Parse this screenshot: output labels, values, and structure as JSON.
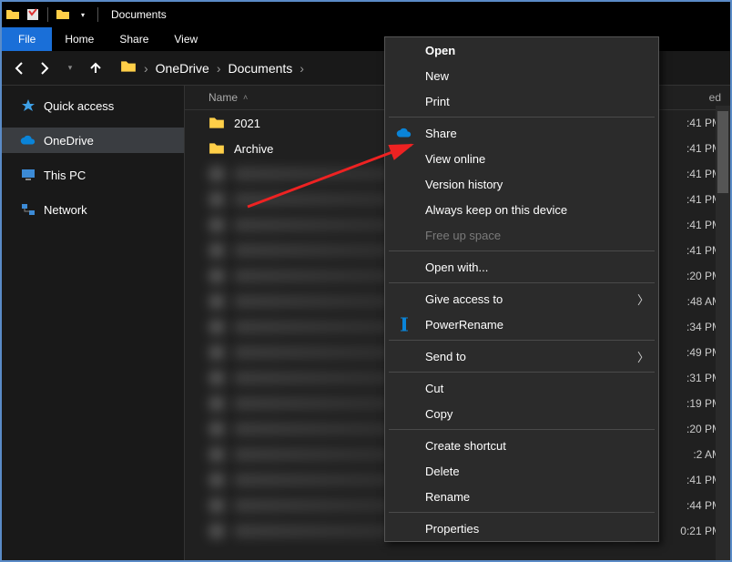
{
  "titlebar": {
    "title": "Documents"
  },
  "ribbon": {
    "file": "File",
    "tabs": [
      "Home",
      "Share",
      "View"
    ]
  },
  "breadcrumb": {
    "items": [
      "OneDrive",
      "Documents"
    ]
  },
  "sidebar": {
    "items": [
      {
        "label": "Quick access"
      },
      {
        "label": "OneDrive"
      },
      {
        "label": "This PC"
      },
      {
        "label": "Network"
      }
    ]
  },
  "columns": {
    "name": "Name",
    "date_partial": "ed"
  },
  "files": {
    "visible": [
      {
        "name": "2021",
        "date": ":41 PM"
      },
      {
        "name": "Archive",
        "date": ":41 PM"
      }
    ],
    "blurred_dates": [
      ":41 PM",
      ":41 PM",
      ":41 PM",
      ":41 PM",
      ":20 PM",
      ":48 AM",
      ":34 PM",
      ":49 PM",
      ":31 PM",
      ":19 PM",
      ":20 PM",
      ":2 AM",
      ":41 PM",
      ":44 PM",
      "0:21 PM"
    ],
    "truncated_last": "):21 PM"
  },
  "ctx": {
    "items": [
      {
        "label": "Open",
        "bold": true
      },
      {
        "label": "New"
      },
      {
        "label": "Print"
      },
      {
        "sep": true
      },
      {
        "label": "Share",
        "icon": "cloud"
      },
      {
        "label": "View online"
      },
      {
        "label": "Version history"
      },
      {
        "label": "Always keep on this device"
      },
      {
        "label": "Free up space",
        "disabled": true
      },
      {
        "sep": true
      },
      {
        "label": "Open with..."
      },
      {
        "sep": true
      },
      {
        "label": "Give access to",
        "submenu": true
      },
      {
        "label": "PowerRename",
        "icon": "powerrename"
      },
      {
        "sep": true
      },
      {
        "label": "Send to",
        "submenu": true
      },
      {
        "sep": true
      },
      {
        "label": "Cut"
      },
      {
        "label": "Copy"
      },
      {
        "sep": true
      },
      {
        "label": "Create shortcut"
      },
      {
        "label": "Delete"
      },
      {
        "label": "Rename"
      },
      {
        "sep": true
      },
      {
        "label": "Properties"
      }
    ]
  }
}
